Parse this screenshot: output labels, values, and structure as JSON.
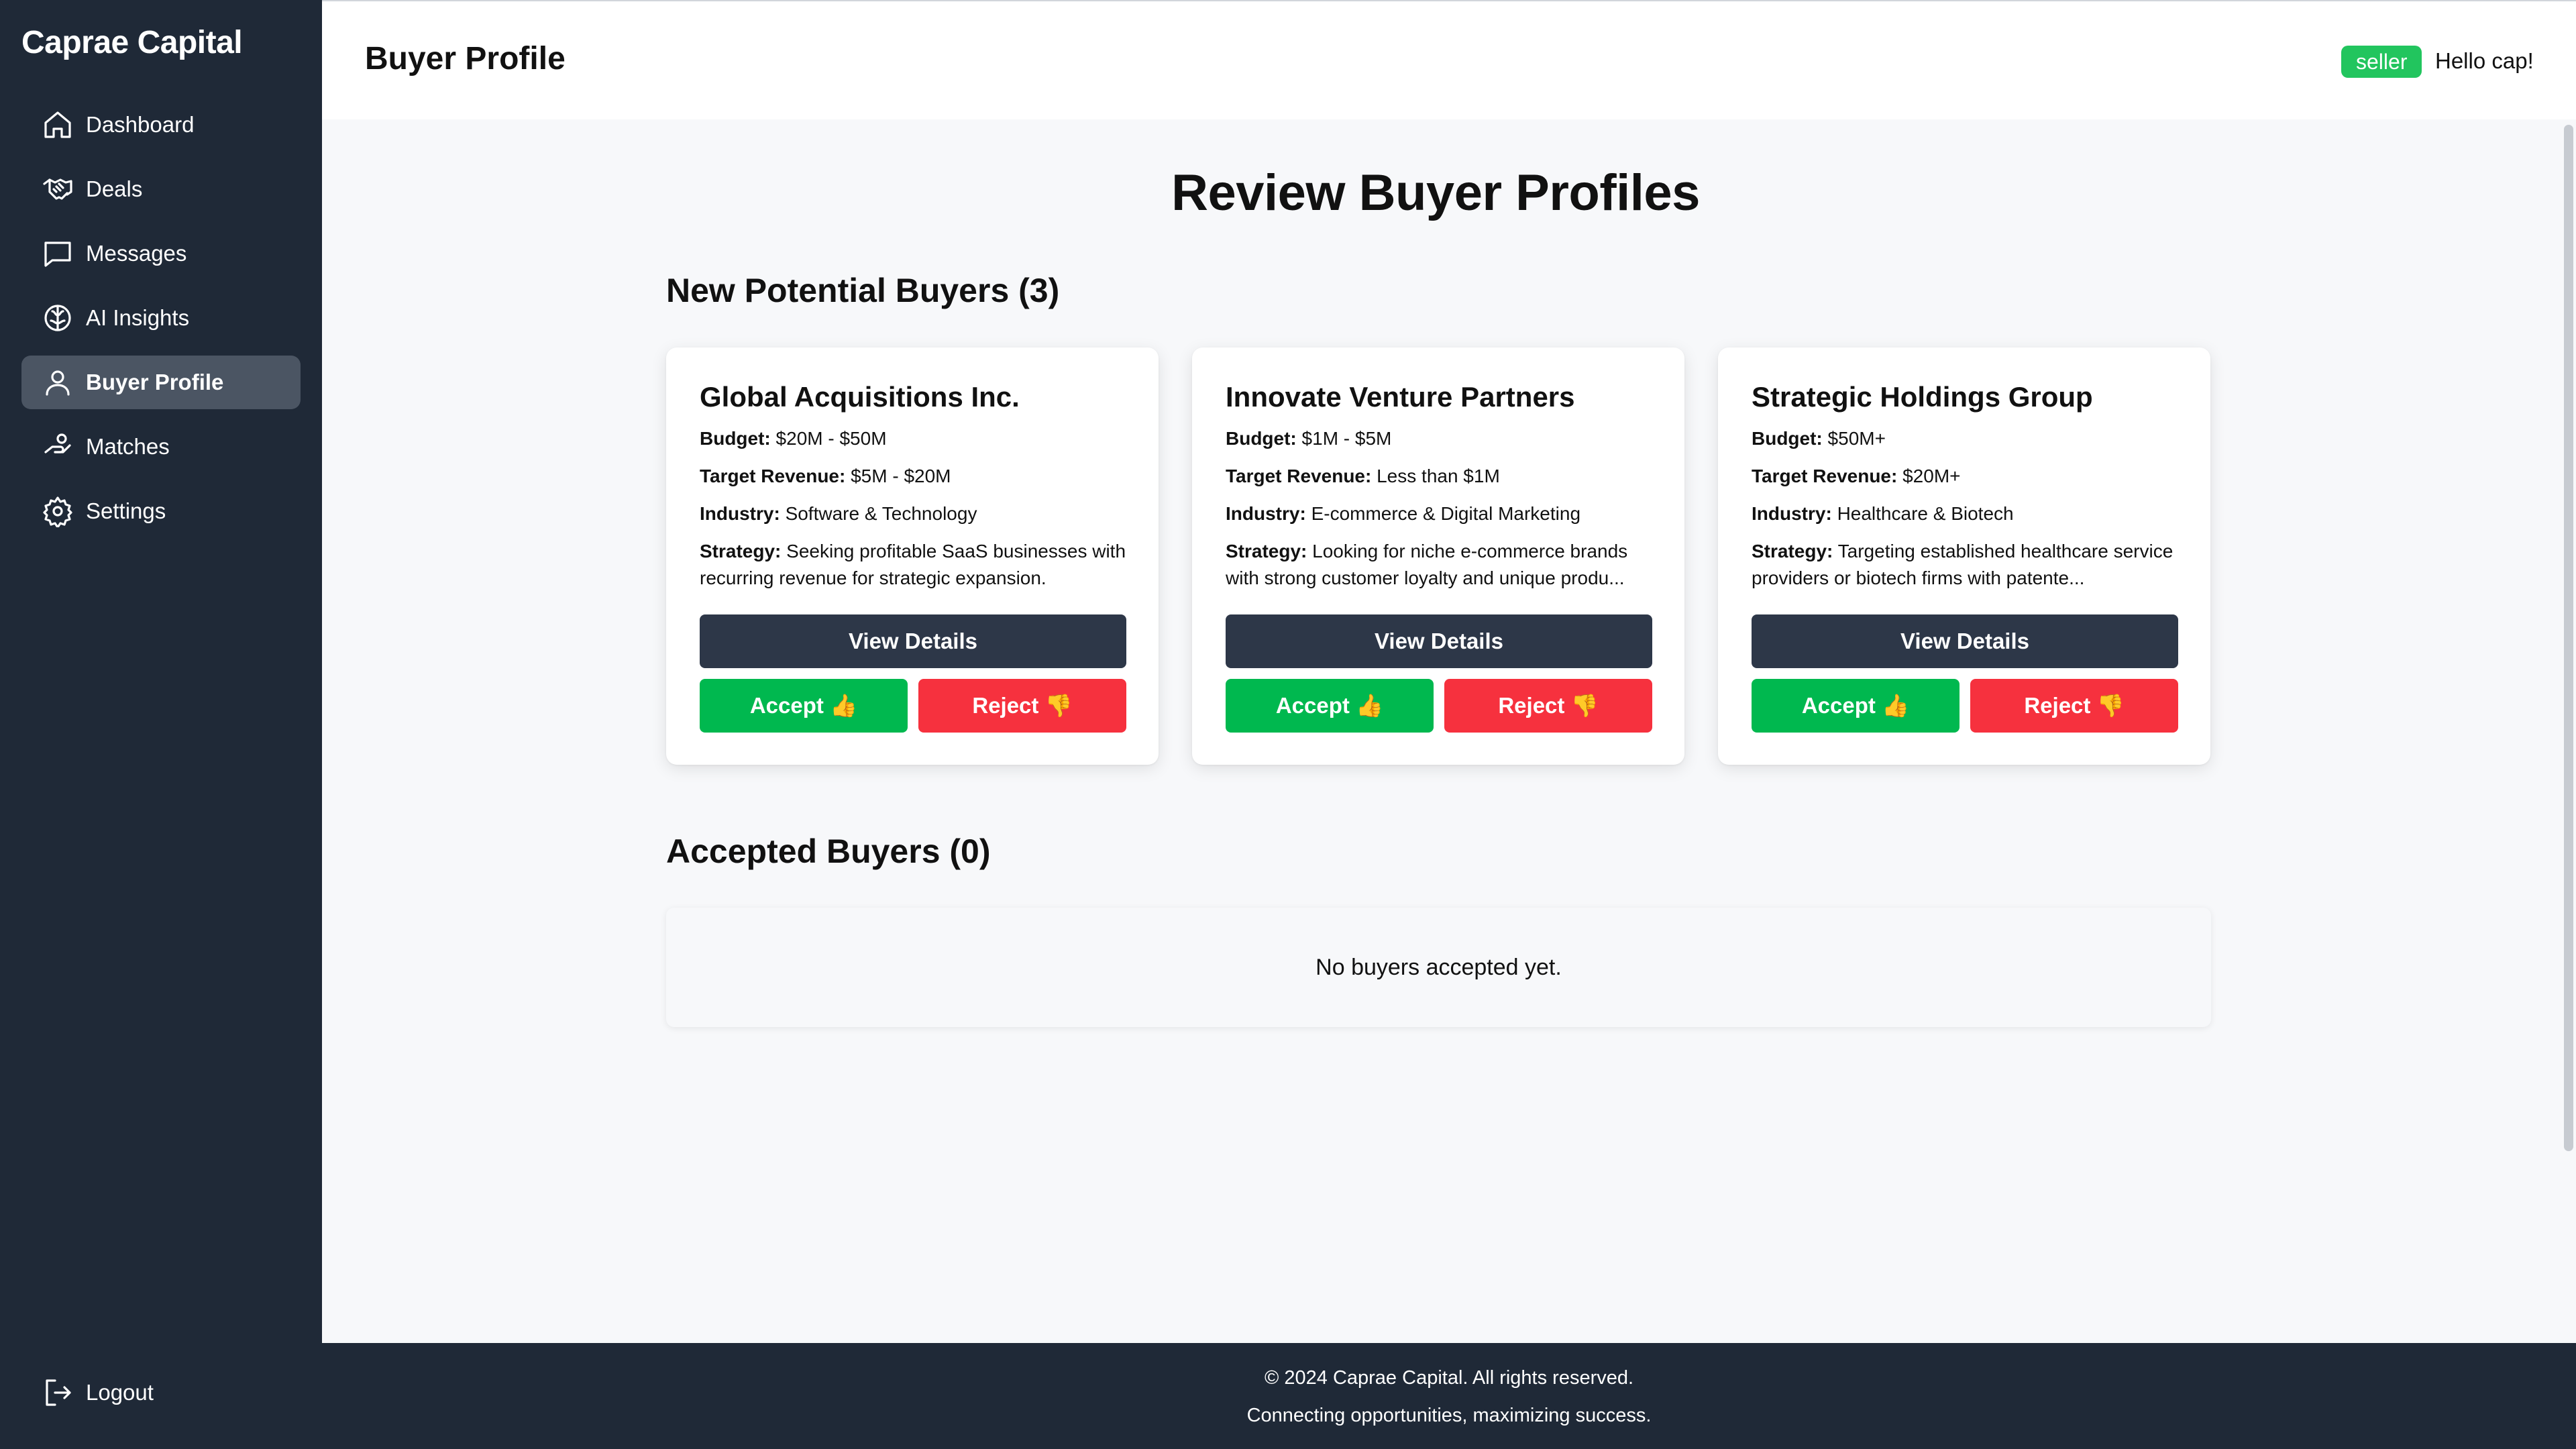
{
  "brand": "Caprae Capital",
  "sidebar": {
    "items": [
      {
        "label": "Dashboard",
        "icon": "home-icon"
      },
      {
        "label": "Deals",
        "icon": "handshake-icon"
      },
      {
        "label": "Messages",
        "icon": "message-icon"
      },
      {
        "label": "AI Insights",
        "icon": "brain-icon"
      },
      {
        "label": "Buyer Profile",
        "icon": "user-icon",
        "active": true
      },
      {
        "label": "Matches",
        "icon": "hand-coins-icon"
      },
      {
        "label": "Settings",
        "icon": "gear-icon"
      }
    ],
    "logout": "Logout"
  },
  "header": {
    "title": "Buyer Profile",
    "role_badge": "seller",
    "greeting": "Hello cap!"
  },
  "main": {
    "title": "Review Buyer Profiles",
    "new_section_title": "New Potential Buyers (3)",
    "accepted_section_title": "Accepted Buyers (0)",
    "accepted_empty": "No buyers accepted yet.",
    "field_labels": {
      "budget": "Budget:",
      "target_revenue": "Target Revenue:",
      "industry": "Industry:",
      "strategy": "Strategy:"
    },
    "buttons": {
      "view": "View Details",
      "accept": "Accept 👍",
      "reject": "Reject 👎"
    },
    "buyers": [
      {
        "name": "Global Acquisitions Inc.",
        "budget": "$20M - $50M",
        "target_revenue": "$5M - $20M",
        "industry": "Software & Technology",
        "strategy": "Seeking profitable SaaS businesses with recurring revenue for strategic expansion."
      },
      {
        "name": "Innovate Venture Partners",
        "budget": "$1M - $5M",
        "target_revenue": "Less than $1M",
        "industry": "E-commerce & Digital Marketing",
        "strategy": "Looking for niche e-commerce brands with strong customer loyalty and unique produ..."
      },
      {
        "name": "Strategic Holdings Group",
        "budget": "$50M+",
        "target_revenue": "$20M+",
        "industry": "Healthcare & Biotech",
        "strategy": "Targeting established healthcare service providers or biotech firms with patente..."
      }
    ]
  },
  "footer": {
    "copyright": "© 2024 Caprae Capital. All rights reserved.",
    "tagline": "Connecting opportunities, maximizing success."
  },
  "colors": {
    "sidebar_bg": "#1f2937",
    "active_item": "#4b5563",
    "accept": "#00b84f",
    "reject": "#f6313e",
    "view": "#2d3748",
    "badge": "#22c55e"
  }
}
